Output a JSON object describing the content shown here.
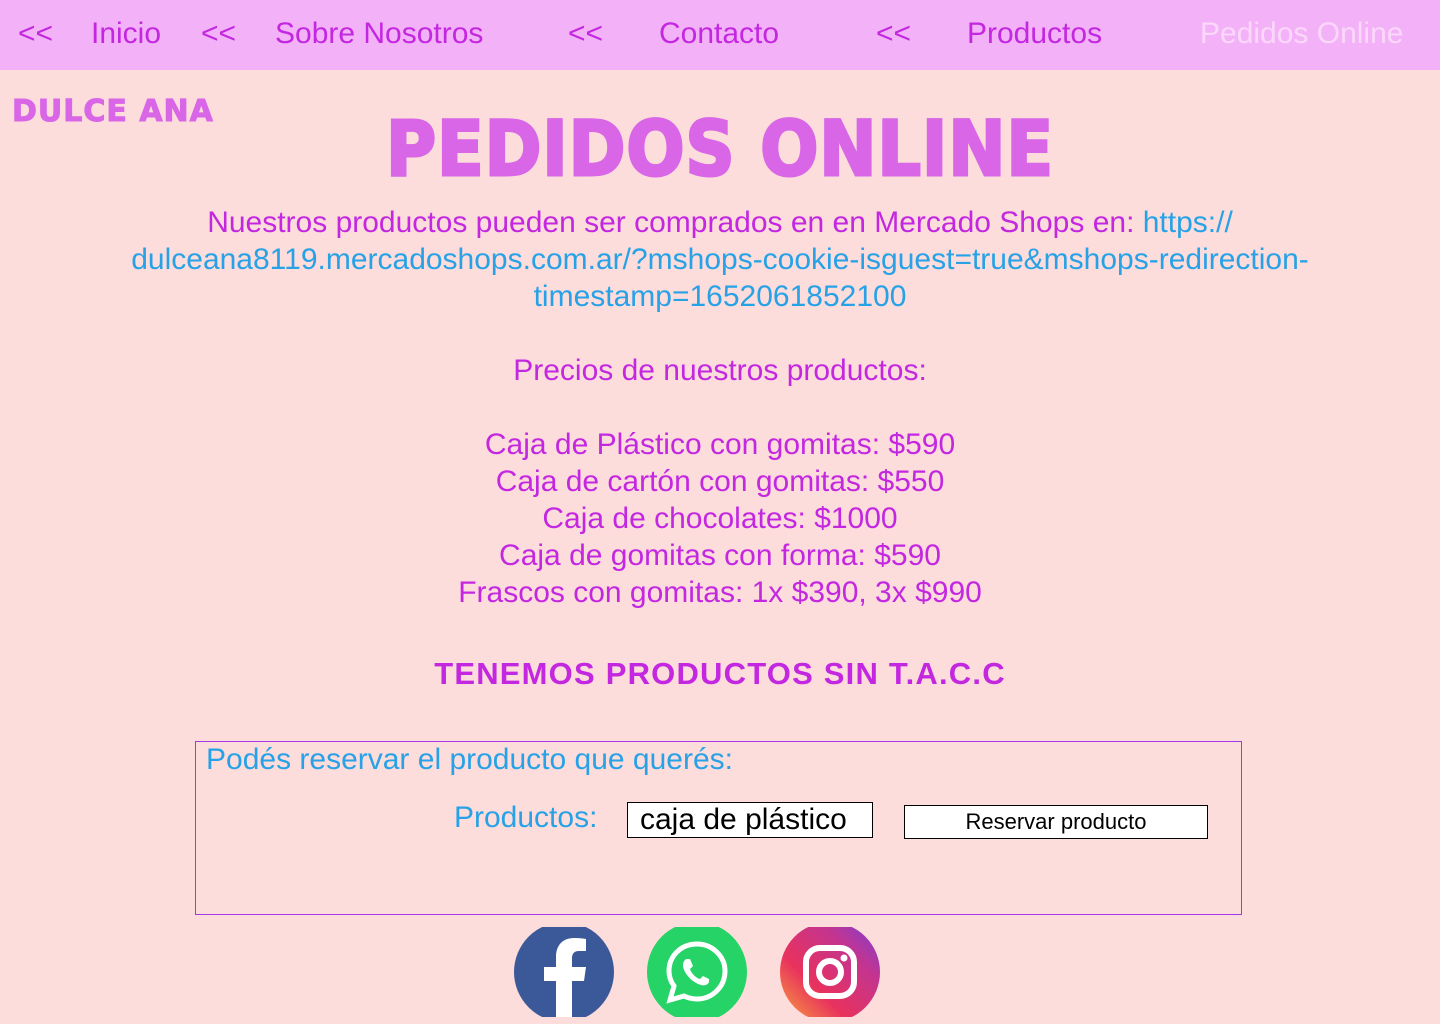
{
  "nav": {
    "arrow": "<<",
    "items": [
      {
        "label": "Inicio"
      },
      {
        "label": "Sobre Nosotros"
      },
      {
        "label": "Contacto"
      },
      {
        "label": "Productos"
      },
      {
        "label": "Pedidos Online"
      }
    ]
  },
  "brand": "DULCE ANA",
  "page_title": "PEDIDOS ONLINE",
  "intro": {
    "text": "Nuestros productos pueden ser comprados en en Mercado Shops en: ",
    "link_line1": "https://",
    "link_line2": "dulceana8119.mercadoshops.com.ar/?mshops-cookie-isguest=true&mshops-redirection-",
    "link_line3": "timestamp=1652061852100"
  },
  "prices_title": "Precios de nuestros productos:",
  "prices": [
    "Caja de Plástico con gomitas: $590",
    "Caja de cartón con gomitas: $550",
    "Caja de chocolates: $1000",
    "Caja de gomitas con forma: $590",
    "Frascos con gomitas: 1x $390, 3x $990"
  ],
  "tacc": "TENEMOS PRODUCTOS SIN T.A.C.C",
  "form": {
    "heading": "Podés reservar el producto que querés:",
    "product_label": "Productos:",
    "selected_product": "caja de plástico",
    "submit_label": "Reservar producto"
  },
  "social": {
    "facebook_color": "#3b5998",
    "whatsapp_color": "#25d366",
    "instagram_colors": [
      "#f9a73b",
      "#e8325e",
      "#c4348f",
      "#7a3fd6"
    ]
  },
  "colors": {
    "background": "#fddcdc",
    "nav_background": "#f3b1f7",
    "accent_purple": "#c327e0",
    "title_purple": "#d866e6",
    "link_blue": "#27a2e6"
  }
}
